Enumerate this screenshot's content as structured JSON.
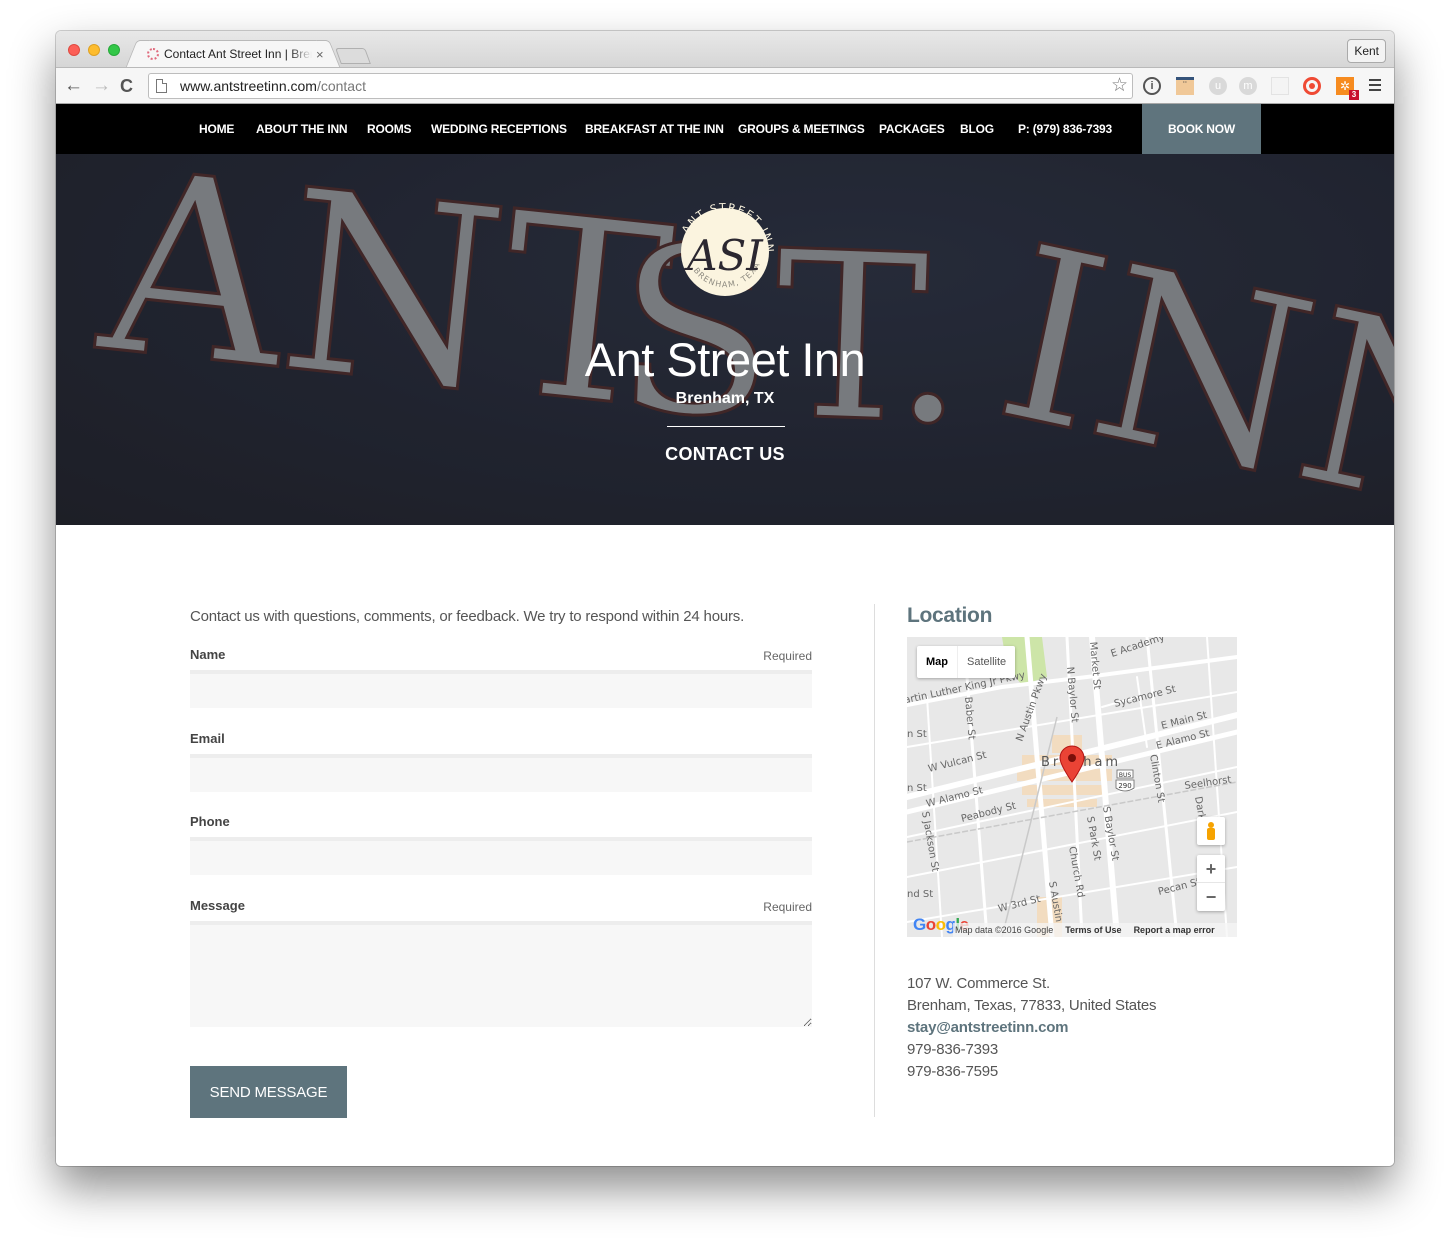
{
  "browser": {
    "tab_title": "Contact Ant Street Inn | Brenham",
    "tab_close": "×",
    "profile": "Kent",
    "url_host": "www.antstreetinn.com",
    "url_path": "/contact",
    "nav_back": "←",
    "nav_forward": "→",
    "nav_reload": "C",
    "star": "☆",
    "extensions": [
      {
        "name": "1password-icon",
        "glyph": "i"
      },
      {
        "name": "face-extension-icon",
        "glyph": "¨"
      },
      {
        "name": "u-extension-icon",
        "glyph": "u"
      },
      {
        "name": "m-extension-icon",
        "glyph": "m"
      },
      {
        "name": "chart-extension-icon",
        "glyph": ""
      },
      {
        "name": "target-extension-icon",
        "glyph": ""
      },
      {
        "name": "hubspot-icon",
        "glyph": "✲",
        "badge": "3"
      }
    ]
  },
  "site_nav": {
    "items": [
      {
        "label": "HOME"
      },
      {
        "label": "ABOUT THE INN"
      },
      {
        "label": "ROOMS"
      },
      {
        "label": "WEDDING RECEPTIONS"
      },
      {
        "label": "BREAKFAST AT THE INN"
      },
      {
        "label": "GROUPS & MEETINGS"
      },
      {
        "label": "PACKAGES"
      },
      {
        "label": "BLOG"
      }
    ],
    "phone": "P: (979) 836-7393",
    "book_now": "BOOK NOW"
  },
  "hero": {
    "background_letters": "ANT ST. INN",
    "logo_top_text": "ANT STREET INN",
    "logo_monogram": "ASI",
    "logo_bottom_text": "BRENHAM, TEXAS",
    "title": "Ant Street Inn",
    "subtitle": "Brenham, TX",
    "page_title": "CONTACT US"
  },
  "form": {
    "intro": "Contact us with questions, comments, or feedback. We try to respond within 24 hours.",
    "fields": [
      {
        "label": "Name",
        "required": "Required",
        "value": ""
      },
      {
        "label": "Email",
        "required": "",
        "value": ""
      },
      {
        "label": "Phone",
        "required": "",
        "value": ""
      },
      {
        "label": "Message",
        "required": "Required",
        "value": ""
      }
    ],
    "submit": "SEND MESSAGE"
  },
  "location": {
    "title": "Location",
    "map": {
      "type_map": "Map",
      "type_satellite": "Satellite",
      "city_label": "Brenham",
      "streets": [
        "Martin Luther King Jr Pkwy",
        "E Academy",
        "Market St",
        "N Baylor St",
        "N Austin Pkwy",
        "Baber St",
        "Sycamore St",
        "E Main St",
        "E Alamo St",
        "W Vulcan St",
        "W Alamo St",
        "Peabody St",
        "S Jackson St",
        "S Baylor St",
        "S Park St",
        "Church Rd",
        "Clinton St",
        "Seelhorst",
        "Pecan St",
        "W 3rd St",
        "S Austin",
        "Dark"
      ],
      "highway_label": "BUS",
      "highway_number": "290",
      "zoom_in": "+",
      "zoom_out": "−",
      "footer_data": "Map data ©2016 Google",
      "footer_terms": "Terms of Use",
      "footer_report": "Report a map error"
    },
    "address_line1": "107 W. Commerce St.",
    "address_line2": "Brenham, Texas, 77833, United States",
    "email": "stay@antstreetinn.com",
    "phone1": "979-836-7393",
    "phone2": "979-836-7595"
  },
  "colors": {
    "accent": "#5e747d",
    "nav_bg": "#000000",
    "input_bg": "#f7f7f7"
  }
}
